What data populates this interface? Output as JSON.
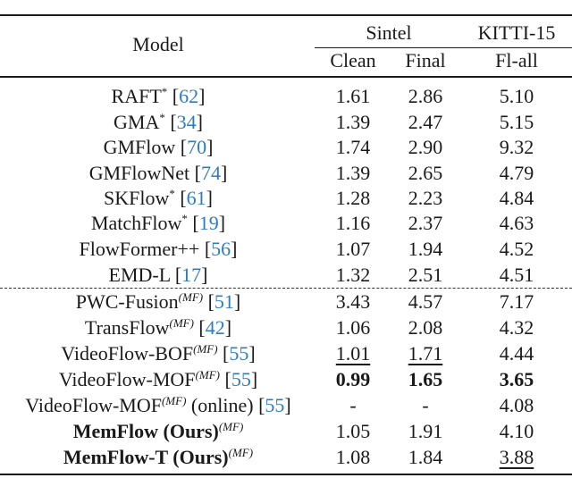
{
  "table": {
    "header": {
      "model": "Model",
      "group_sintel": "Sintel",
      "group_kitti": "KITTI-15",
      "col_clean": "Clean",
      "col_final": "Final",
      "col_flall": "Fl-all"
    },
    "citation_color": "#2f7bbf",
    "rows": [
      {
        "name": "RAFT",
        "sup": "*",
        "cite": "62",
        "clean": "1.61",
        "final": "2.86",
        "flall": "5.10"
      },
      {
        "name": "GMA",
        "sup": "*",
        "cite": "34",
        "clean": "1.39",
        "final": "2.47",
        "flall": "5.15"
      },
      {
        "name": "GMFlow",
        "sup": "",
        "cite": "70",
        "clean": "1.74",
        "final": "2.90",
        "flall": "9.32"
      },
      {
        "name": "GMFlowNet",
        "sup": "",
        "cite": "74",
        "clean": "1.39",
        "final": "2.65",
        "flall": "4.79"
      },
      {
        "name": "SKFlow",
        "sup": "*",
        "cite": "61",
        "clean": "1.28",
        "final": "2.23",
        "flall": "4.84"
      },
      {
        "name": "MatchFlow",
        "sup": "*",
        "cite": "19",
        "clean": "1.16",
        "final": "2.37",
        "flall": "4.63"
      },
      {
        "name": "FlowFormer++",
        "sup": "",
        "cite": "56",
        "clean": "1.07",
        "final": "1.94",
        "flall": "4.52"
      },
      {
        "name": "EMD-L",
        "sup": "",
        "cite": "17",
        "clean": "1.32",
        "final": "2.51",
        "flall": "4.51"
      },
      {
        "name": "PWC-Fusion",
        "sup": "(MF)",
        "cite": "51",
        "clean": "3.43",
        "final": "4.57",
        "flall": "7.17"
      },
      {
        "name": "TransFlow",
        "sup": "(MF)",
        "cite": "42",
        "clean": "1.06",
        "final": "2.08",
        "flall": "4.32"
      },
      {
        "name": "VideoFlow-BOF",
        "sup": "(MF)",
        "cite": "55",
        "clean": "1.01",
        "final": "1.71",
        "flall": "4.44",
        "underline": [
          "clean",
          "final"
        ]
      },
      {
        "name": "VideoFlow-MOF",
        "sup": "(MF)",
        "cite": "55",
        "clean": "0.99",
        "final": "1.65",
        "flall": "3.65",
        "bold_values": [
          "clean",
          "final",
          "flall"
        ]
      },
      {
        "name": "VideoFlow-MOF",
        "sup": "(MF)",
        "suffix": " (online)",
        "cite": "55",
        "clean": "-",
        "final": "-",
        "flall": "4.08"
      },
      {
        "name": "MemFlow (Ours)",
        "sup": "(MF)",
        "cite": "",
        "clean": "1.05",
        "final": "1.91",
        "flall": "4.10",
        "bold_name": true
      },
      {
        "name": "MemFlow-T (Ours)",
        "sup": "(MF)",
        "cite": "",
        "clean": "1.08",
        "final": "1.84",
        "flall": "3.88",
        "bold_name": true,
        "underline": [
          "flall"
        ]
      }
    ]
  }
}
